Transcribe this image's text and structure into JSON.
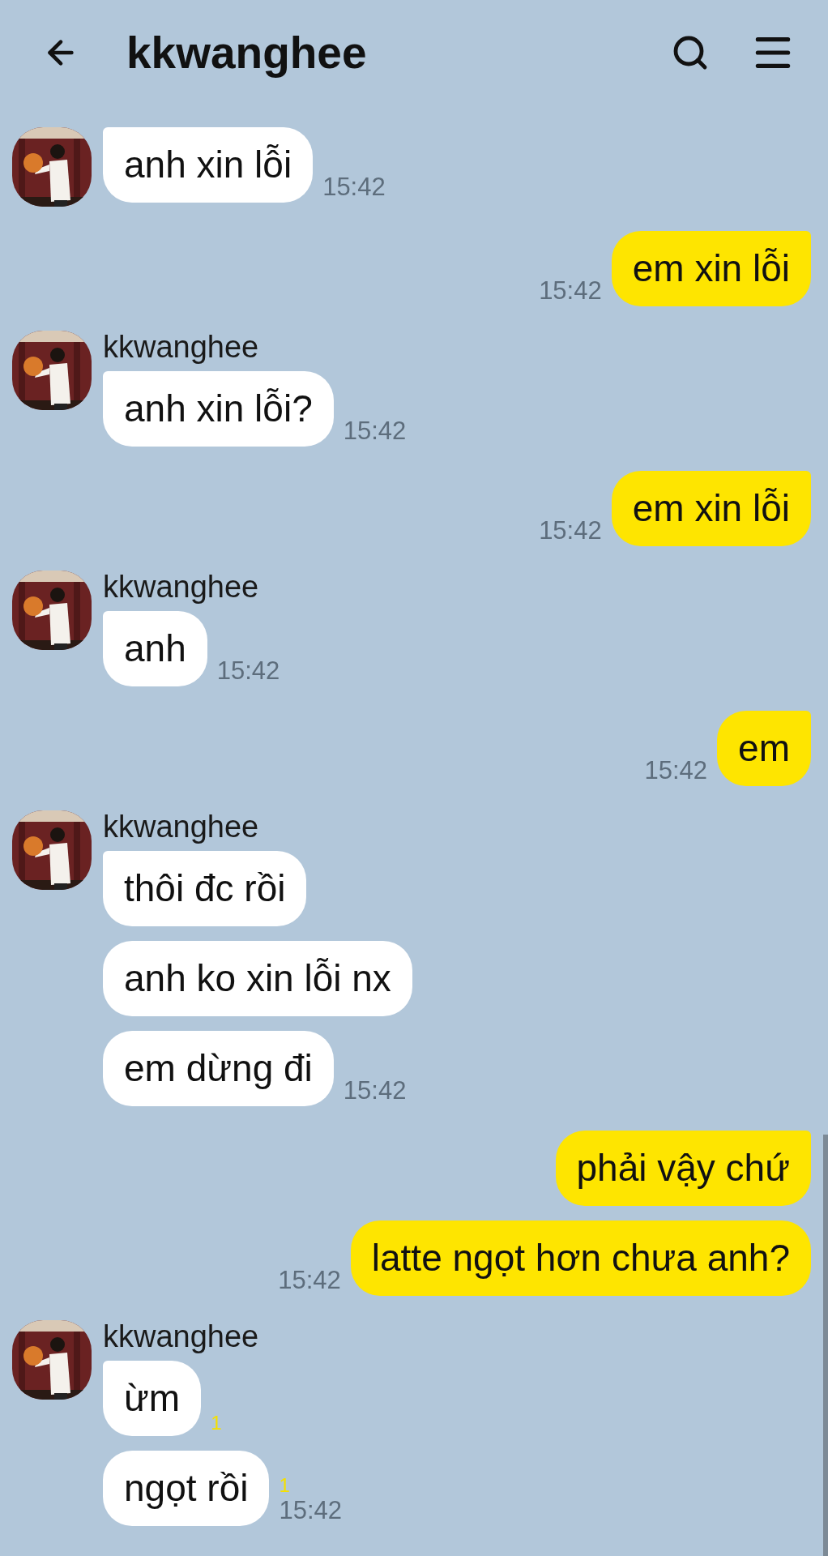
{
  "header": {
    "title": "kkwanghee"
  },
  "groups": [
    {
      "kind": "received",
      "avatar": {
        "kind": "picture"
      },
      "bubbles": [
        {
          "text": "anh xin lỗi"
        }
      ],
      "time": "15:42"
    },
    {
      "kind": "sent",
      "bubbles": [
        {
          "text": "em xin lỗi"
        }
      ],
      "time": "15:42"
    },
    {
      "kind": "received",
      "sender": "kkwanghee",
      "avatar": {
        "kind": "picture"
      },
      "bubbles": [
        {
          "text": "anh xin lỗi?"
        }
      ],
      "time": "15:42"
    },
    {
      "kind": "sent",
      "bubbles": [
        {
          "text": "em xin lỗi"
        }
      ],
      "time": "15:42"
    },
    {
      "kind": "received",
      "sender": "kkwanghee",
      "avatar": {
        "kind": "picture"
      },
      "bubbles": [
        {
          "text": "anh"
        }
      ],
      "time": "15:42"
    },
    {
      "kind": "sent",
      "bubbles": [
        {
          "text": "em"
        }
      ],
      "time": "15:42"
    },
    {
      "kind": "received",
      "sender": "kkwanghee",
      "avatar": {
        "kind": "picture"
      },
      "bubbles": [
        {
          "text": "thôi đc rồi"
        },
        {
          "text": "anh ko xin lỗi nx"
        },
        {
          "text": "em dừng đi"
        }
      ],
      "time": "15:42"
    },
    {
      "kind": "sent",
      "bubbles": [
        {
          "text": "phải vậy chứ"
        },
        {
          "text": "latte ngọt hơn chưa anh?"
        }
      ],
      "time": "15:42"
    },
    {
      "kind": "received",
      "sender": "kkwanghee",
      "avatar": {
        "kind": "picture"
      },
      "bubbles": [
        {
          "text": "ừm",
          "unread": "1"
        },
        {
          "text": "ngọt rồi",
          "unread": "1"
        }
      ],
      "time": "15:42"
    }
  ]
}
